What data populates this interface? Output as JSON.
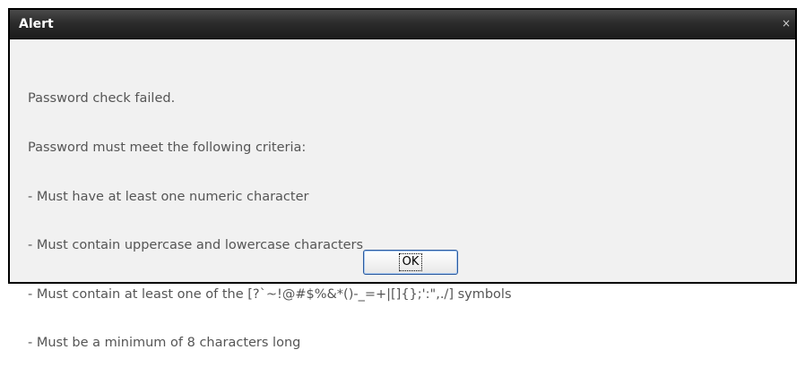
{
  "dialog": {
    "title": "Alert",
    "close_glyph": "×",
    "message_lines": [
      "Password check failed.",
      "Password must meet the following criteria:",
      "- Must have at least one numeric character",
      "- Must contain uppercase and lowercase characters",
      "- Must contain at least one of the [?`~!@#$%&*()-_=+|[]{};':\",./] symbols",
      "- Must be a minimum of 8 characters long"
    ],
    "ok_label": "OK"
  },
  "colors": {
    "titlebar": "#2c2c2c",
    "title_text": "#ffffff",
    "body_background": "#f1f1f1",
    "message_text": "#555555",
    "button_border": "#2b5a9e"
  },
  "icons": {
    "close": "close-icon"
  }
}
